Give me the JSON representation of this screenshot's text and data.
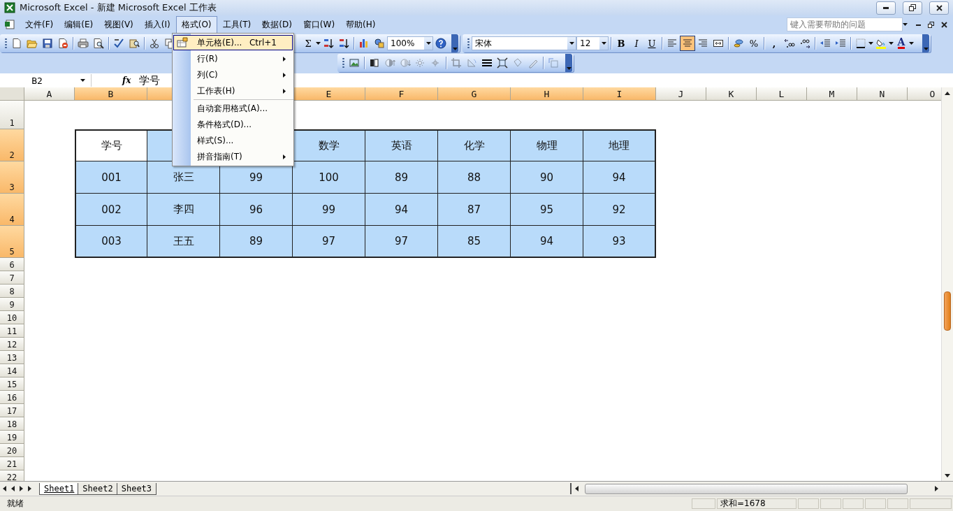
{
  "window": {
    "title": "Microsoft Excel - 新建 Microsoft Excel 工作表"
  },
  "menu_bar": {
    "items": [
      {
        "label": "文件(F)",
        "selected": false
      },
      {
        "label": "编辑(E)",
        "selected": false
      },
      {
        "label": "视图(V)",
        "selected": false
      },
      {
        "label": "插入(I)",
        "selected": false
      },
      {
        "label": "格式(O)",
        "selected": true
      },
      {
        "label": "工具(T)",
        "selected": false
      },
      {
        "label": "数据(D)",
        "selected": false
      },
      {
        "label": "窗口(W)",
        "selected": false
      },
      {
        "label": "帮助(H)",
        "selected": false
      }
    ],
    "help_field": {
      "placeholder": "键入需要帮助的问题"
    }
  },
  "standard_toolbar": [
    {
      "kind": "new"
    },
    {
      "kind": "open"
    },
    {
      "kind": "save"
    },
    {
      "kind": "permission"
    },
    {
      "kind": "separator"
    },
    {
      "kind": "print"
    },
    {
      "kind": "preview"
    },
    {
      "kind": "separator"
    },
    {
      "kind": "spelling"
    },
    {
      "kind": "research"
    },
    {
      "kind": "separator"
    },
    {
      "kind": "cut"
    },
    {
      "kind": "copy"
    },
    {
      "kind": "gap"
    },
    {
      "kind": "autosum",
      "text": "Σ",
      "dropdown": true
    },
    {
      "kind": "sort-asc"
    },
    {
      "kind": "sort-desc"
    },
    {
      "kind": "separator"
    },
    {
      "kind": "chart"
    },
    {
      "kind": "drawing"
    },
    {
      "kind": "combo",
      "value": "100%"
    },
    {
      "kind": "help"
    }
  ],
  "formatting_toolbar": [
    {
      "kind": "font",
      "value": "宋体"
    },
    {
      "kind": "size",
      "value": "12"
    },
    {
      "kind": "separator"
    },
    {
      "kind": "bold",
      "text": "B"
    },
    {
      "kind": "italic",
      "text": "I"
    },
    {
      "kind": "underline",
      "text": "U"
    },
    {
      "kind": "separator"
    },
    {
      "kind": "align-left",
      "selected": false
    },
    {
      "kind": "align-center",
      "selected": true
    },
    {
      "kind": "align-right",
      "selected": false
    },
    {
      "kind": "merge",
      "selected": false
    },
    {
      "kind": "separator"
    },
    {
      "kind": "currency"
    },
    {
      "kind": "percent",
      "text": "%"
    },
    {
      "kind": "separator"
    },
    {
      "kind": "comma",
      "text": ","
    },
    {
      "kind": "increase-decimal"
    },
    {
      "kind": "decrease-decimal"
    },
    {
      "kind": "separator"
    },
    {
      "kind": "outdent"
    },
    {
      "kind": "indent"
    },
    {
      "kind": "separator"
    },
    {
      "kind": "borders",
      "dropdown": true
    },
    {
      "kind": "fill-color",
      "dropdown": true
    },
    {
      "kind": "font-color",
      "text": "A",
      "dropdown": true
    }
  ],
  "picture_toolbar": [
    {
      "kind": "insert-picture",
      "disabled": false
    },
    {
      "kind": "separator"
    },
    {
      "kind": "color",
      "disabled": false
    },
    {
      "kind": "more-contrast",
      "disabled": true
    },
    {
      "kind": "less-contrast",
      "disabled": true
    },
    {
      "kind": "more-brightness",
      "disabled": true
    },
    {
      "kind": "less-brightness",
      "disabled": true
    },
    {
      "kind": "separator"
    },
    {
      "kind": "crop",
      "disabled": true
    },
    {
      "kind": "rotate",
      "disabled": true
    },
    {
      "kind": "line-style",
      "disabled": false
    },
    {
      "kind": "compress",
      "disabled": false
    },
    {
      "kind": "format-picture",
      "disabled": true
    },
    {
      "kind": "set-transparent",
      "disabled": true
    },
    {
      "kind": "separator"
    },
    {
      "kind": "reset-picture",
      "disabled": true
    }
  ],
  "formula_bar": {
    "name_box": "B2",
    "fx": "fx",
    "value": "学号"
  },
  "sheet": {
    "columns": [
      {
        "label": "A",
        "selected": false
      },
      {
        "label": "B",
        "selected": true
      },
      {
        "selected": true
      },
      null,
      {
        "label": "E",
        "selected": true
      },
      {
        "label": "F",
        "selected": true
      },
      {
        "label": "G",
        "selected": true
      },
      {
        "label": "H",
        "selected": true
      },
      {
        "label": "I",
        "selected": true
      },
      {
        "label": "J",
        "selected": false
      },
      {
        "label": "K",
        "selected": false
      },
      {
        "label": "L",
        "selected": false
      },
      {
        "label": "M",
        "selected": false
      },
      {
        "label": "N",
        "selected": false
      },
      {
        "label": "O",
        "selected": false
      }
    ],
    "rows": [
      {
        "label": "1",
        "selected": false
      },
      {
        "label": "2",
        "selected": true,
        "cells": [
          {
            "text": "学号",
            "active": true
          },
          {},
          null,
          {
            "text": "数学",
            "active": false
          },
          {
            "text": "英语",
            "active": false
          },
          {
            "text": "化学",
            "active": false
          },
          {
            "text": "物理",
            "active": false
          },
          {
            "text": "地理",
            "active": false
          }
        ]
      },
      {
        "label": "3",
        "selected": true,
        "cells": [
          {
            "text": "001",
            "active": false
          },
          {
            "text": "张三",
            "active": false
          },
          {
            "text": "99",
            "active": false
          },
          {
            "text": "100",
            "active": false
          },
          {
            "text": "89",
            "active": false
          },
          {
            "text": "88",
            "active": false
          },
          {
            "text": "90",
            "active": false
          },
          {
            "text": "94",
            "active": false
          }
        ]
      },
      {
        "label": "4",
        "selected": true,
        "cells": [
          {
            "text": "002",
            "active": false
          },
          {
            "text": "李四",
            "active": false
          },
          {
            "text": "96",
            "active": false
          },
          {
            "text": "99",
            "active": false
          },
          {
            "text": "94",
            "active": false
          },
          {
            "text": "87",
            "active": false
          },
          {
            "text": "95",
            "active": false
          },
          {
            "text": "92",
            "active": false
          }
        ]
      },
      {
        "label": "5",
        "selected": true,
        "cells": [
          {
            "text": "003",
            "active": false
          },
          {
            "text": "王五",
            "active": false
          },
          {
            "text": "89",
            "active": false
          },
          {
            "text": "97",
            "active": false
          },
          {
            "text": "97",
            "active": false
          },
          {
            "text": "85",
            "active": false
          },
          {
            "text": "94",
            "active": false
          },
          {
            "text": "93",
            "active": false
          }
        ]
      },
      {
        "label": "6",
        "selected": false
      },
      {
        "label": "7",
        "selected": false
      },
      {
        "label": "8",
        "selected": false
      },
      {
        "label": "9",
        "selected": false
      },
      {
        "label": "10",
        "selected": false
      },
      {
        "label": "11",
        "selected": false
      },
      {
        "label": "12",
        "selected": false
      },
      {
        "label": "13",
        "selected": false
      },
      {
        "label": "14",
        "selected": false
      },
      {
        "label": "15",
        "selected": false
      },
      {
        "label": "16",
        "selected": false
      },
      {
        "label": "17",
        "selected": false
      },
      {
        "label": "18",
        "selected": false
      },
      {
        "label": "19",
        "selected": false
      },
      {
        "label": "20",
        "selected": false
      },
      {
        "label": "21",
        "selected": false
      },
      {
        "label": "22",
        "selected": false
      }
    ]
  },
  "format_menu": [
    {
      "kind": "item",
      "label": "单元格(E)...",
      "shortcut": "Ctrl+1",
      "icon": true,
      "submenu": false,
      "selected": true
    },
    {
      "kind": "item",
      "label": "行(R)",
      "submenu": true,
      "selected": false
    },
    {
      "kind": "item",
      "label": "列(C)",
      "submenu": true,
      "selected": false
    },
    {
      "kind": "item",
      "label": "工作表(H)",
      "submenu": true,
      "selected": false
    },
    {
      "kind": "separator"
    },
    {
      "kind": "item",
      "label": "自动套用格式(A)...",
      "submenu": false,
      "selected": false
    },
    {
      "kind": "item",
      "label": "条件格式(D)...",
      "submenu": false,
      "selected": false
    },
    {
      "kind": "item",
      "label": "样式(S)...",
      "submenu": false,
      "selected": false
    },
    {
      "kind": "item",
      "label": "拼音指南(T)",
      "submenu": true,
      "selected": false
    }
  ],
  "sheet_tabs": [
    {
      "label": "Sheet1",
      "selected": true
    },
    {
      "label": "Sheet2",
      "selected": false
    },
    {
      "label": "Sheet3",
      "selected": false
    }
  ],
  "status_bar": {
    "status": "就绪",
    "sum": "求和=1678"
  }
}
